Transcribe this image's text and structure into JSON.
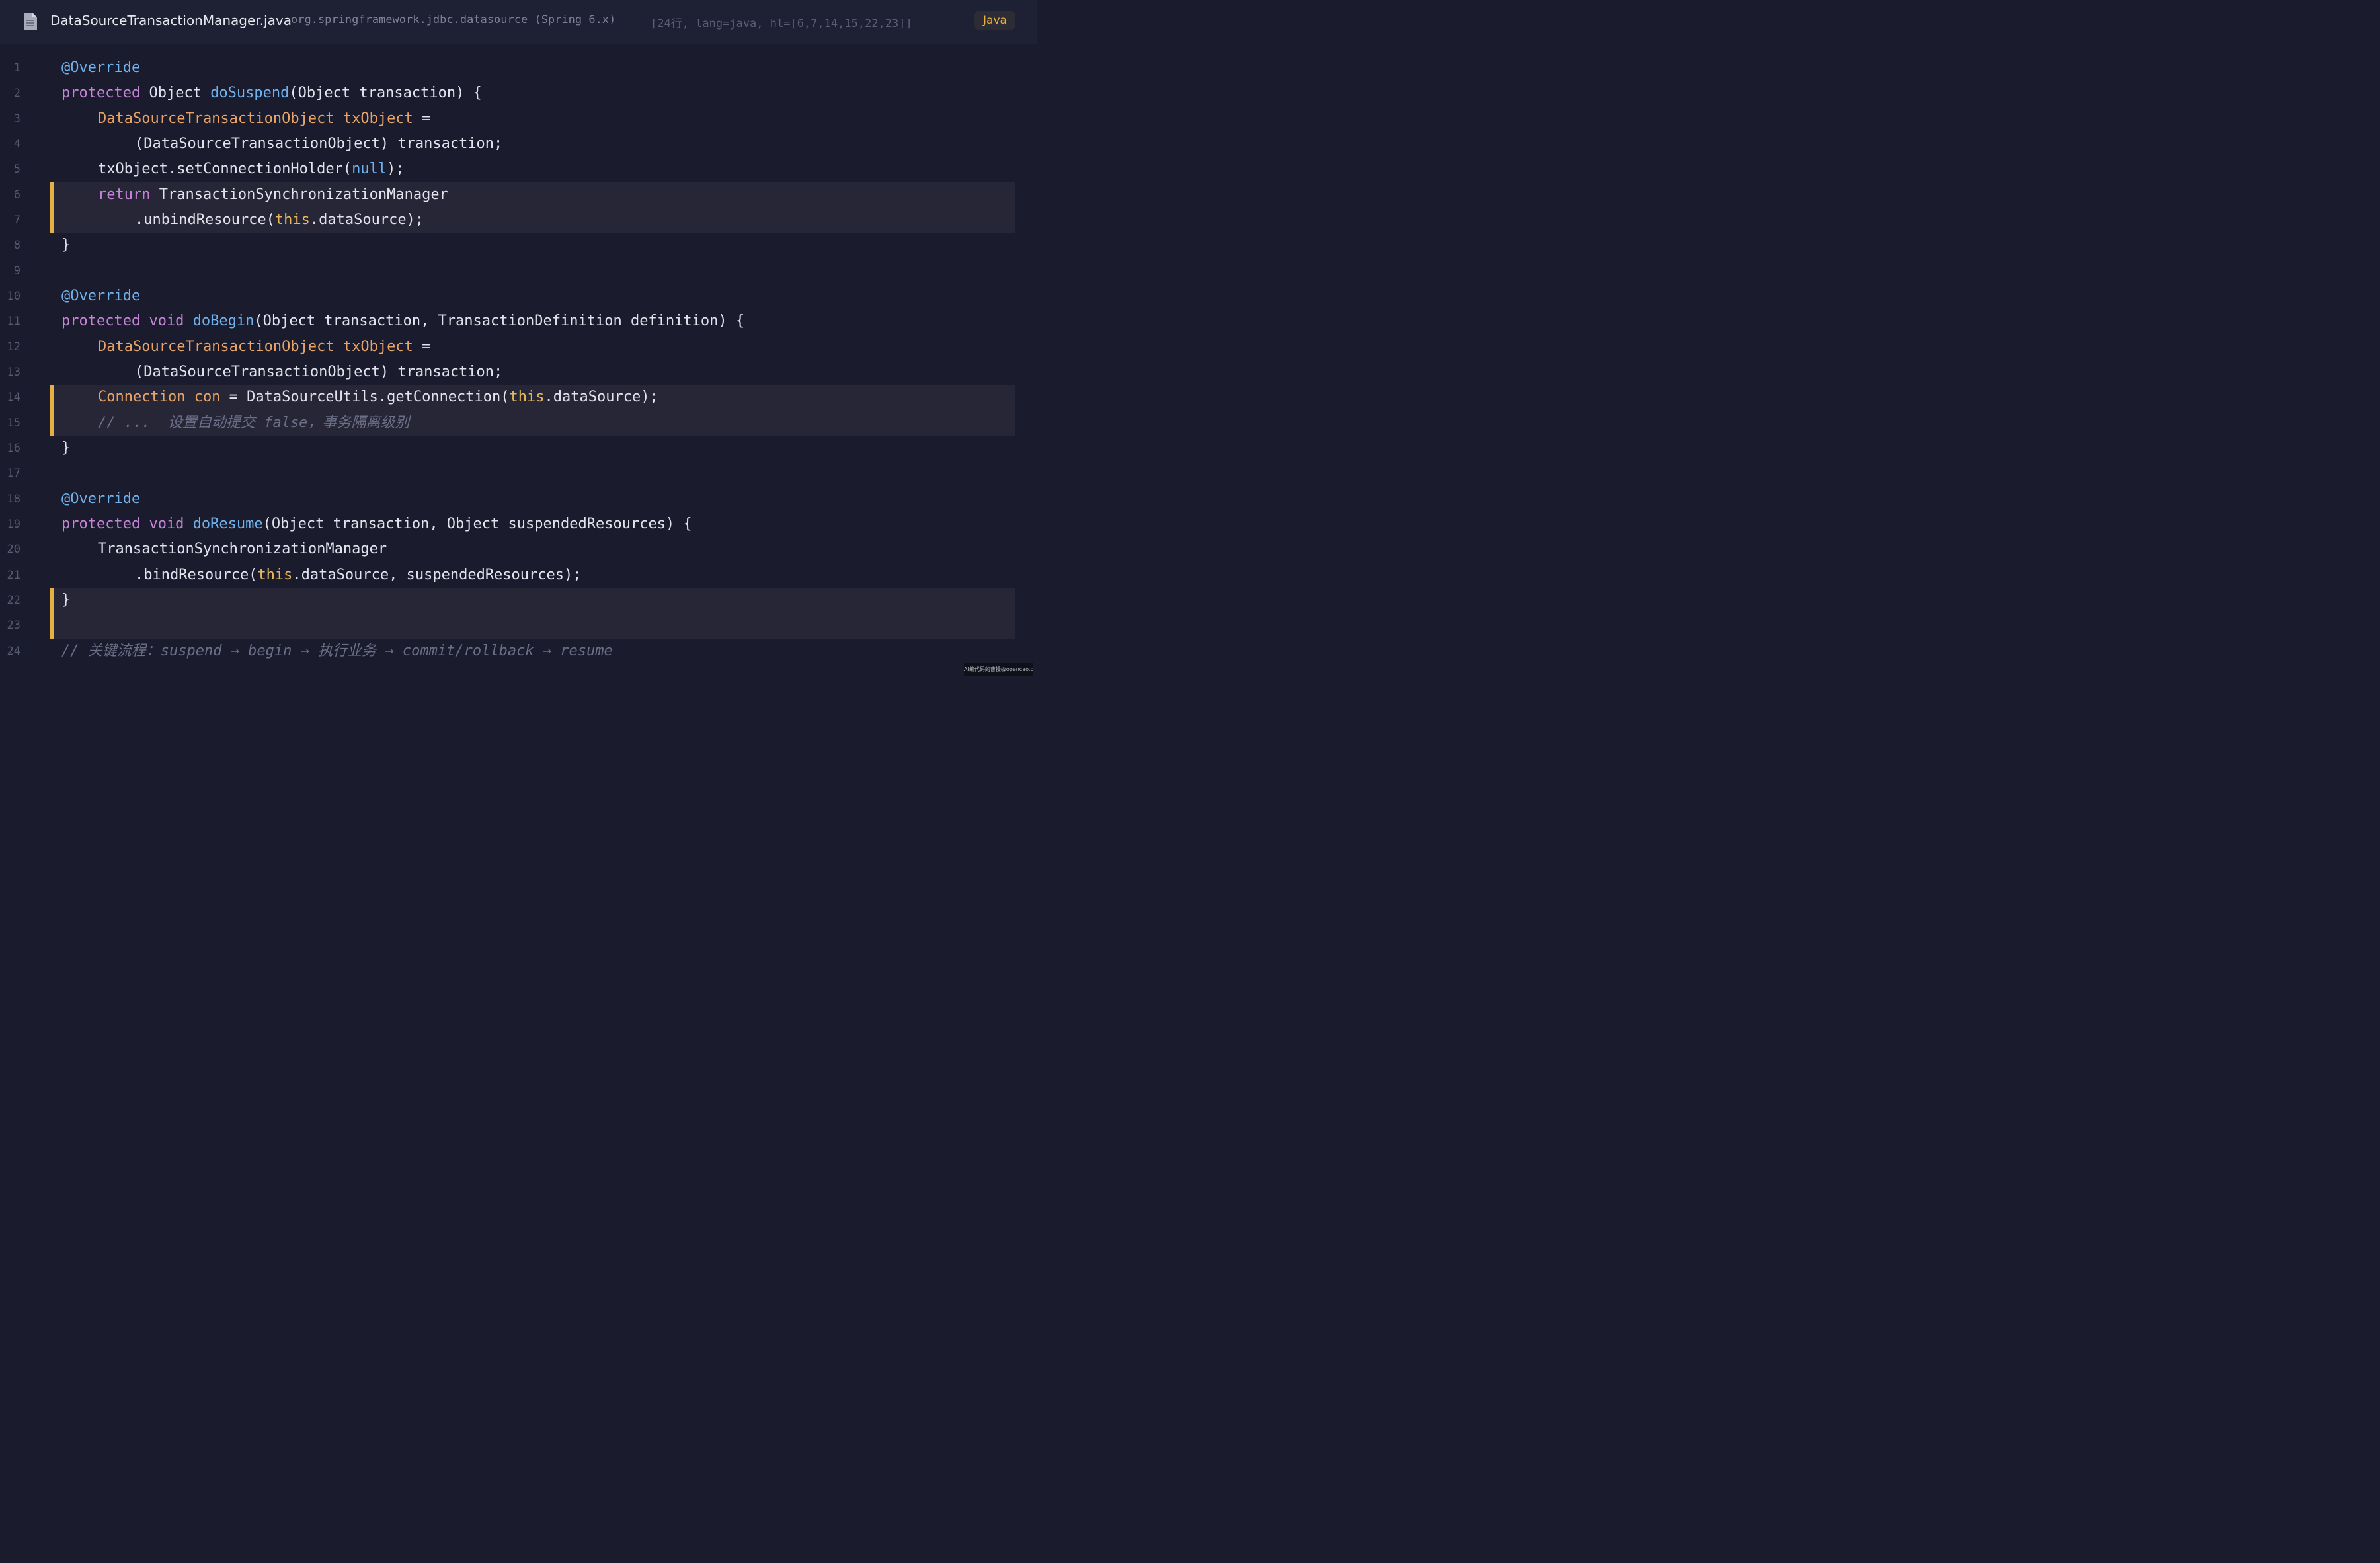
{
  "header": {
    "icon": "file-icon",
    "file_name": "DataSourceTransactionManager.java",
    "package": "org.springframework.jdbc.datasource (Spring 6.x)",
    "meta": "[24行, lang=java, hl=[6,7,14,15,22,23]]",
    "language": "Java"
  },
  "colors": {
    "background": "#1a1b2c",
    "keyword": "#c584d8",
    "function": "#6fb2ee",
    "type": "#e8a367",
    "highlight_bar": "#e4b041",
    "comment": "#6b6e86"
  },
  "editor": {
    "highlighted_lines": [
      6,
      7,
      14,
      15,
      22,
      23
    ],
    "lines": [
      {
        "n": "1",
        "t": {
          "a": "@Override"
        }
      },
      {
        "n": "2",
        "t": {
          "a": "protected",
          "b": " Object ",
          "c": "doSuspend",
          "d": "(Object transaction) {"
        }
      },
      {
        "n": "3",
        "t": {
          "a": "DataSourceTransactionObject txObject",
          "b": " ="
        }
      },
      {
        "n": "4",
        "t": {
          "a": "(DataSourceTransactionObject) transaction;"
        }
      },
      {
        "n": "5",
        "t": {
          "a": "txObject.setConnectionHolder(",
          "b": "null",
          "c": ");"
        }
      },
      {
        "n": "6",
        "t": {
          "a": "return",
          "b": " TransactionSynchronizationManager"
        }
      },
      {
        "n": "7",
        "t": {
          "a": ".unbindResource(",
          "b": "this",
          "c": ".dataSource);"
        }
      },
      {
        "n": "8",
        "t": {
          "a": "}"
        }
      },
      {
        "n": "9",
        "t": {}
      },
      {
        "n": "10",
        "t": {
          "a": "@Override"
        }
      },
      {
        "n": "11",
        "t": {
          "a": "protected void",
          "b": " ",
          "c": "doBegin",
          "d": "(Object transaction, TransactionDefinition definition) {"
        }
      },
      {
        "n": "12",
        "t": {
          "a": "DataSourceTransactionObject txObject",
          "b": " ="
        }
      },
      {
        "n": "13",
        "t": {
          "a": "(DataSourceTransactionObject) transaction;"
        }
      },
      {
        "n": "14",
        "t": {
          "a": "Connection con",
          "b": " = DataSourceUtils.getConnection(",
          "c": "this",
          "d": ".dataSource);"
        }
      },
      {
        "n": "15",
        "t": {
          "a": "// ...  设置自动提交 false，事务隔离级别"
        }
      },
      {
        "n": "16",
        "t": {
          "a": "}"
        }
      },
      {
        "n": "17",
        "t": {}
      },
      {
        "n": "18",
        "t": {
          "a": "@Override"
        }
      },
      {
        "n": "19",
        "t": {
          "a": "protected void",
          "b": " ",
          "c": "doResume",
          "d": "(Object transaction, Object suspendedResources) {"
        }
      },
      {
        "n": "20",
        "t": {
          "a": "TransactionSynchronizationManager"
        }
      },
      {
        "n": "21",
        "t": {
          "a": ".bindResource(",
          "b": "this",
          "c": ".dataSource, suspendedResources);"
        }
      },
      {
        "n": "22",
        "t": {
          "a": "}"
        }
      },
      {
        "n": "23",
        "t": {}
      },
      {
        "n": "24",
        "t": {
          "a": "// 关键流程：suspend → begin → 执行业务 → commit/rollback → resume"
        }
      }
    ]
  },
  "watermark": "AI编代码的曹操@opencao.cn"
}
